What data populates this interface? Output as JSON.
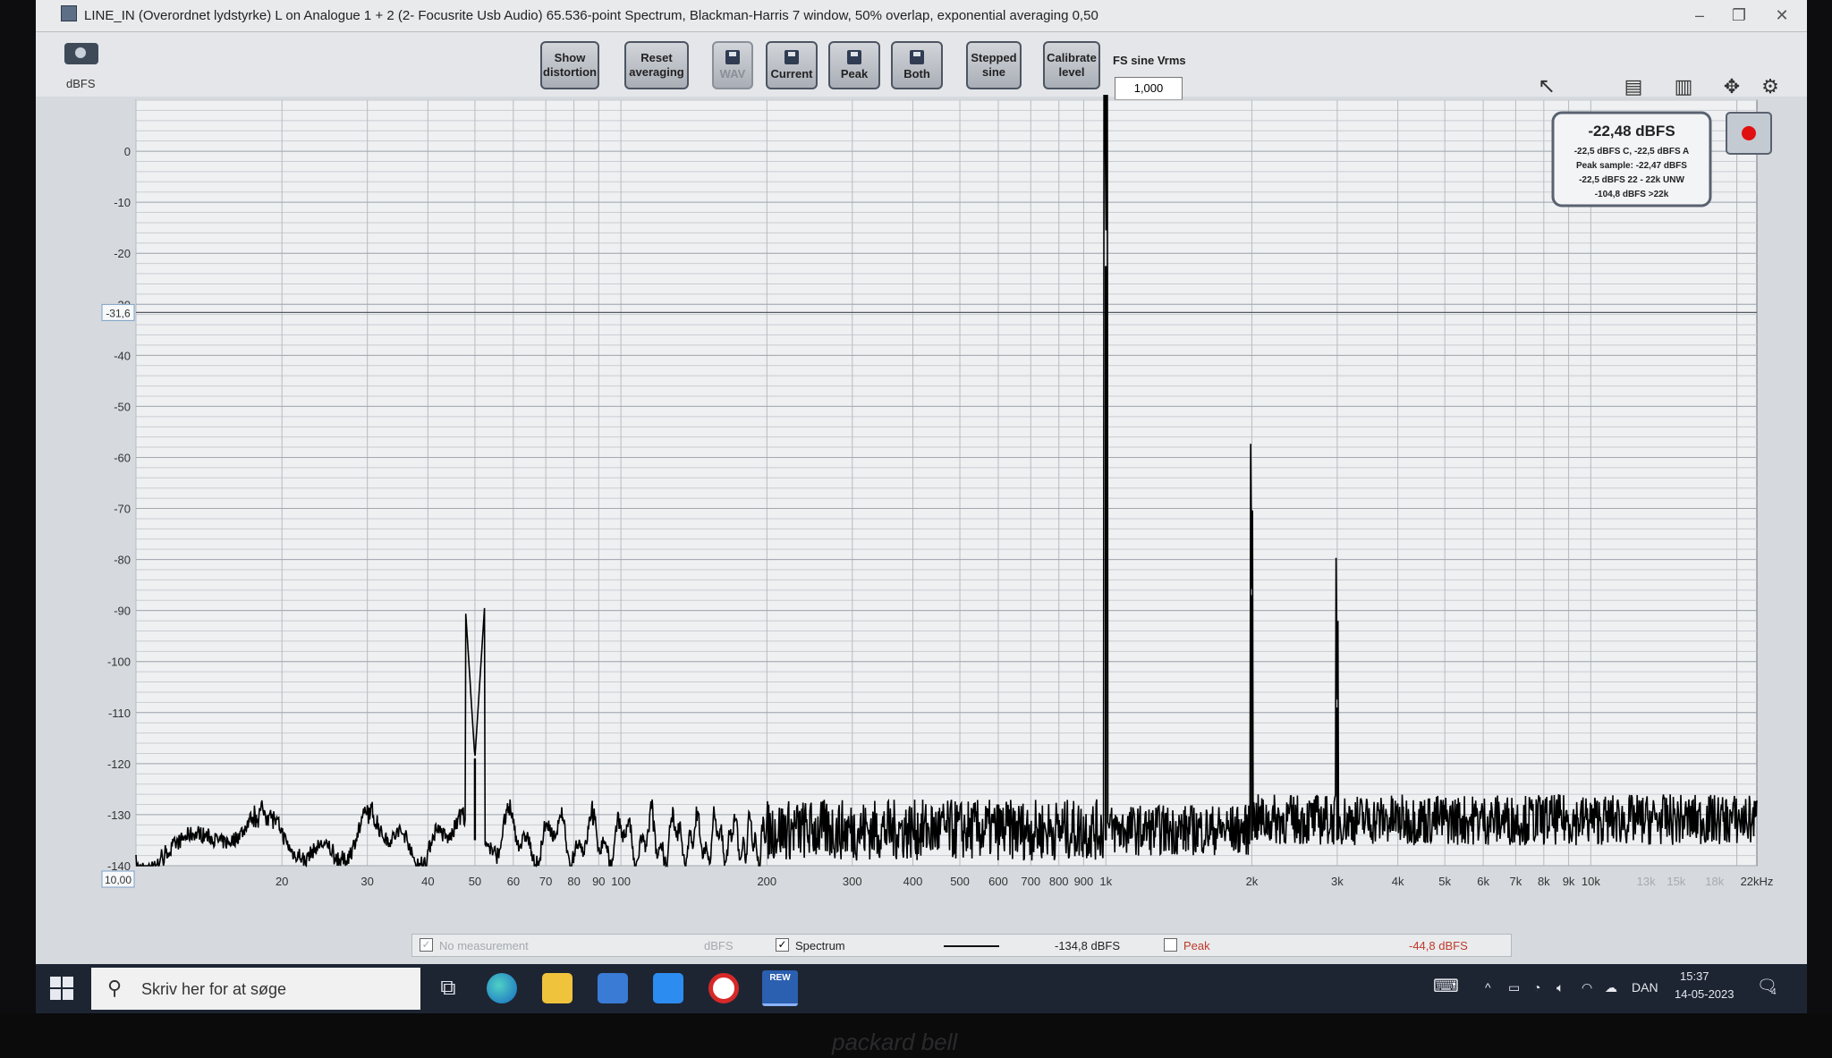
{
  "window": {
    "title": "LINE_IN (Overordnet lydstyrke) L on Analogue 1 + 2 (2- Focusrite Usb Audio) 65.536-point Spectrum, Blackman-Harris 7 window, 50% overlap, exponential averaging 0,50"
  },
  "toolbar": {
    "show_distortion": [
      "Show",
      "distortion"
    ],
    "reset_averaging": [
      "Reset",
      "averaging"
    ],
    "wav": "WAV",
    "current": "Current",
    "peak": "Peak",
    "both": "Both",
    "stepped_sine": [
      "Stepped",
      "sine"
    ],
    "calibrate_level": [
      "Calibrate",
      "level"
    ],
    "fs_sine_label": "FS sine Vrms",
    "fs_sine_value": "1,000"
  },
  "readout": {
    "main": "-22,48 dBFS",
    "line1": "-22,5 dBFS C, -22,5 dBFS A",
    "line2": "Peak sample: -22,47 dBFS",
    "line3": "-22,5 dBFS 22 - 22k UNW",
    "line4": "-104,8 dBFS >22k"
  },
  "cursor_level_label": "-31,6",
  "x_start_label": "10,00",
  "legend": {
    "no_measurement": "No measurement",
    "no_measurement_unit": "dBFS",
    "spectrum": "Spectrum",
    "spectrum_value": "-134,8 dBFS",
    "peak": "Peak",
    "peak_value": "-44,8 dBFS"
  },
  "taskbar": {
    "search_placeholder": "Skriv her for at søge",
    "language": "DAN",
    "time": "15:37",
    "date": "14-05-2023",
    "notification_count": "4"
  },
  "chart_data": {
    "type": "line",
    "ylabel": "dBFS",
    "ylim": [
      -140,
      10
    ],
    "xlim": [
      10,
      22000
    ],
    "x_scale": "log",
    "y_ticks": [
      0,
      -10,
      -20,
      -30,
      -40,
      -50,
      -60,
      -70,
      -80,
      -90,
      -100,
      -110,
      -120,
      -130,
      -140
    ],
    "x_tick_labels": [
      {
        "f": 20,
        "t": "20"
      },
      {
        "f": 30,
        "t": "30"
      },
      {
        "f": 40,
        "t": "40"
      },
      {
        "f": 50,
        "t": "50"
      },
      {
        "f": 60,
        "t": "60"
      },
      {
        "f": 70,
        "t": "70"
      },
      {
        "f": 80,
        "t": "80"
      },
      {
        "f": 90,
        "t": "90"
      },
      {
        "f": 100,
        "t": "100"
      },
      {
        "f": 200,
        "t": "200"
      },
      {
        "f": 300,
        "t": "300"
      },
      {
        "f": 400,
        "t": "400"
      },
      {
        "f": 500,
        "t": "500"
      },
      {
        "f": 600,
        "t": "600"
      },
      {
        "f": 700,
        "t": "700"
      },
      {
        "f": 800,
        "t": "800"
      },
      {
        "f": 900,
        "t": "900"
      },
      {
        "f": 1000,
        "t": "1k"
      },
      {
        "f": 2000,
        "t": "2k"
      },
      {
        "f": 3000,
        "t": "3k"
      },
      {
        "f": 4000,
        "t": "4k"
      },
      {
        "f": 5000,
        "t": "5k"
      },
      {
        "f": 6000,
        "t": "6k"
      },
      {
        "f": 7000,
        "t": "7k"
      },
      {
        "f": 8000,
        "t": "8k"
      },
      {
        "f": 9000,
        "t": "9k"
      },
      {
        "f": 10000,
        "t": "10k"
      },
      {
        "f": 13000,
        "t": "13k"
      },
      {
        "f": 15000,
        "t": "15k"
      },
      {
        "f": 18000,
        "t": "18k"
      },
      {
        "f": 22000,
        "t": "22kHz"
      }
    ],
    "series": [
      {
        "name": "Spectrum",
        "color": "#000000",
        "noise_floor_dbfs": -134.8,
        "peaks": [
          {
            "f": 50,
            "db": -119
          },
          {
            "f": 1000,
            "db": -22.5
          },
          {
            "f": 2000,
            "db": -87
          },
          {
            "f": 3000,
            "db": -109
          }
        ]
      }
    ],
    "cursor_y": -31.6,
    "grid": true,
    "legend_position": "bottom"
  }
}
